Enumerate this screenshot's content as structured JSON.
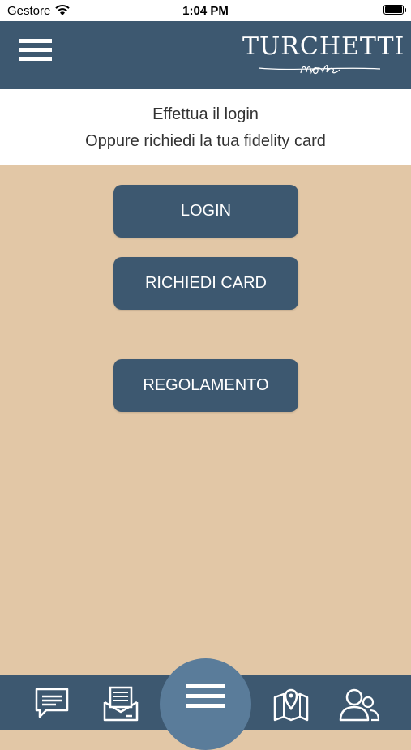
{
  "status_bar": {
    "carrier": "Gestore",
    "time": "1:04 PM"
  },
  "nav": {
    "logo_title": "TURCHETTI",
    "logo_subtitle": "mode"
  },
  "header": {
    "line1": "Effettua il login",
    "line2": "Oppure richiedi la tua fidelity card"
  },
  "buttons": {
    "login": "LOGIN",
    "request_card": "RICHIEDI CARD",
    "rules": "REGOLAMENTO"
  },
  "tab_bar": {
    "icons": [
      "chat-icon",
      "mail-icon",
      "menu-icon",
      "map-icon",
      "users-icon"
    ]
  },
  "colors": {
    "primary": "#3d5870",
    "background": "#e2c7a6",
    "center_button": "#5a7c9a"
  }
}
